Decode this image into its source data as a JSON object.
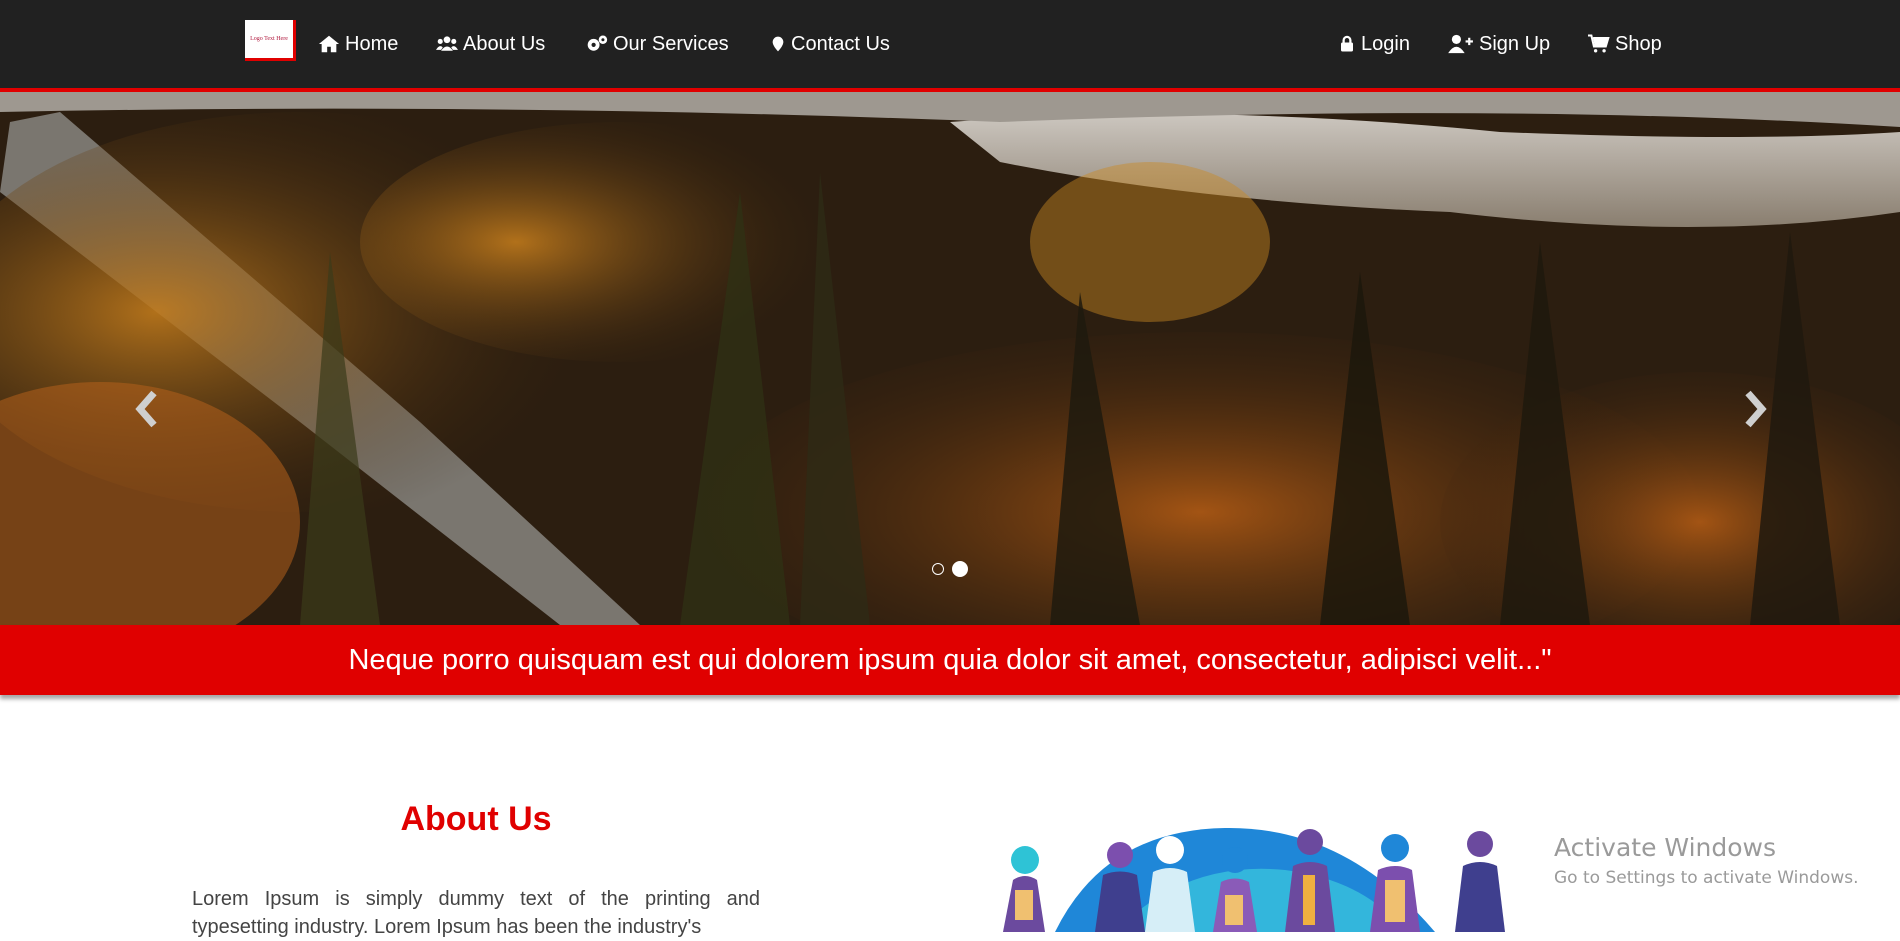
{
  "navbar": {
    "logo_text": "Logo Text Here",
    "left_items": [
      {
        "label": "Home",
        "icon": "home-icon"
      },
      {
        "label": "About Us",
        "icon": "users-icon"
      },
      {
        "label": "Our Services",
        "icon": "gears-icon"
      },
      {
        "label": "Contact Us",
        "icon": "map-marker-icon"
      }
    ],
    "right_items": [
      {
        "label": "Login",
        "icon": "lock-icon"
      },
      {
        "label": "Sign Up",
        "icon": "user-plus-icon"
      },
      {
        "label": "Shop",
        "icon": "cart-icon"
      }
    ]
  },
  "carousel": {
    "prev_icon": "chevron-left-icon",
    "next_icon": "chevron-right-icon",
    "slide_count": 2,
    "active_index": 1
  },
  "banner": {
    "text": "Neque porro quisquam est qui dolorem ipsum quia dolor sit amet, consectetur, adipisci velit...\""
  },
  "about": {
    "title": "About Us",
    "text": "Lorem Ipsum is simply dummy text of the printing and typesetting industry. Lorem Ipsum has been the industry's"
  },
  "watermark": {
    "title": "Activate Windows",
    "subtitle": "Go to Settings to activate Windows."
  },
  "colors": {
    "accent": "#e00000",
    "navbar_bg": "#212121"
  }
}
